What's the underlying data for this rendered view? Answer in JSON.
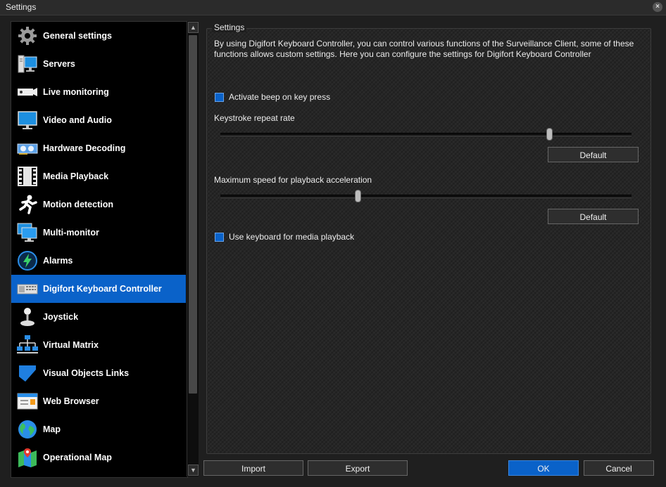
{
  "window": {
    "title": "Settings",
    "close_glyph": "×"
  },
  "sidebar": {
    "items": [
      {
        "label": "General settings",
        "icon": "gear-icon"
      },
      {
        "label": "Servers",
        "icon": "servers-icon"
      },
      {
        "label": "Live monitoring",
        "icon": "camera-icon"
      },
      {
        "label": "Video and Audio",
        "icon": "monitor-icon"
      },
      {
        "label": "Hardware Decoding",
        "icon": "gpu-card-icon"
      },
      {
        "label": "Media Playback",
        "icon": "film-strip-icon"
      },
      {
        "label": "Motion detection",
        "icon": "running-man-icon"
      },
      {
        "label": "Multi-monitor",
        "icon": "multi-monitor-icon"
      },
      {
        "label": "Alarms",
        "icon": "lightning-icon"
      },
      {
        "label": "Digifort Keyboard Controller",
        "icon": "keyboard-controller-icon",
        "selected": true
      },
      {
        "label": "Joystick",
        "icon": "joystick-icon"
      },
      {
        "label": "Virtual Matrix",
        "icon": "network-tree-icon"
      },
      {
        "label": "Visual Objects Links",
        "icon": "blue-shape-icon"
      },
      {
        "label": "Web Browser",
        "icon": "browser-window-icon"
      },
      {
        "label": "Map",
        "icon": "globe-icon"
      },
      {
        "label": "Operational Map",
        "icon": "map-pin-icon"
      }
    ]
  },
  "panel": {
    "caption": "Settings",
    "description": "By using Digifort Keyboard Controller, you can control various functions of the Surveillance Client, some of these functions allows custom settings. Here you can configure the settings for Digifort Keyboard Controller",
    "beep_checkbox": {
      "label": "Activate beep on key press",
      "checked": true
    },
    "keystroke": {
      "label": "Keystroke repeat rate",
      "value_fraction": 0.8,
      "default_label": "Default"
    },
    "playback": {
      "label": "Maximum speed for playback acceleration",
      "value_fraction": 0.335,
      "default_label": "Default"
    },
    "media_checkbox": {
      "label": "Use keyboard for media playback",
      "checked": true
    }
  },
  "footer": {
    "import_label": "Import",
    "export_label": "Export",
    "ok_label": "OK",
    "cancel_label": "Cancel"
  },
  "colors": {
    "accent": "#0a62c9",
    "background": "#1f1f1f",
    "sidebar": "#000000"
  }
}
